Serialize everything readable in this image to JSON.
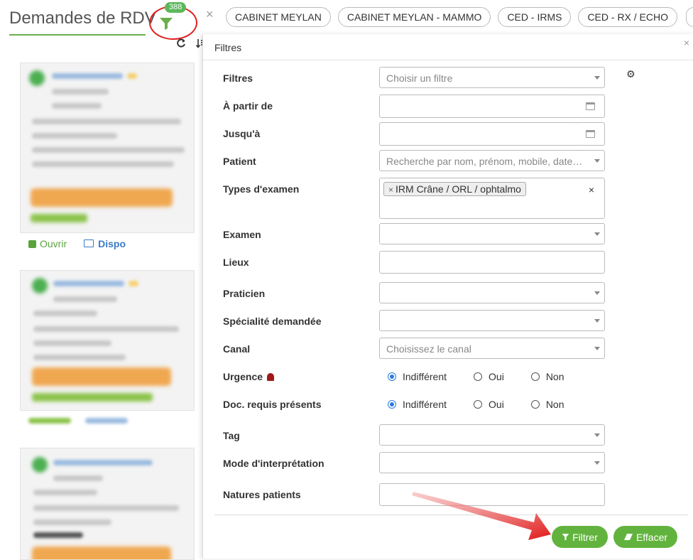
{
  "header": {
    "title": "Demandes de RDV",
    "filter_count": "388",
    "close_symbol": "×"
  },
  "tabs": [
    {
      "label": "CABINET MEYLAN"
    },
    {
      "label": "CABINET MEYLAN - MAMMO"
    },
    {
      "label": "CED - IRMS"
    },
    {
      "label": "CED - RX / ECHO"
    }
  ],
  "card_actions": {
    "open_label": "Ouvrir",
    "dispo_label": "Dispo"
  },
  "panel": {
    "title": "Filtres",
    "close_symbol": "×",
    "rows": {
      "filtres": {
        "label": "Filtres",
        "placeholder": "Choisir un filtre"
      },
      "a_partir_de": {
        "label": "À partir de",
        "value": ""
      },
      "jusqua": {
        "label": "Jusqu'à",
        "value": ""
      },
      "patient": {
        "label": "Patient",
        "placeholder": "Recherche par nom, prénom, mobile, date…"
      },
      "types_examen": {
        "label": "Types d'examen",
        "tags": [
          "IRM Crâne / ORL / ophtalmo"
        ],
        "clear_symbol": "×"
      },
      "examen": {
        "label": "Examen",
        "value": ""
      },
      "lieux": {
        "label": "Lieux",
        "value": ""
      },
      "praticien": {
        "label": "Praticien",
        "value": ""
      },
      "specialite": {
        "label": "Spécialité demandée",
        "value": ""
      },
      "canal": {
        "label": "Canal",
        "placeholder": "Choisissez le canal"
      },
      "urgence": {
        "label": "Urgence",
        "options": [
          "Indifférent",
          "Oui",
          "Non"
        ],
        "selected": "Indifférent"
      },
      "doc_requis": {
        "label": "Doc. requis présents",
        "options": [
          "Indifférent",
          "Oui",
          "Non"
        ],
        "selected": "Indifférent"
      },
      "tag": {
        "label": "Tag",
        "value": ""
      },
      "mode_interpretation": {
        "label": "Mode d'interprétation",
        "value": ""
      },
      "natures_patients": {
        "label": "Natures patients",
        "value": ""
      }
    },
    "buttons": {
      "filter_label": "Filtrer",
      "clear_label": "Effacer"
    }
  },
  "colors": {
    "accent_green": "#62b33e",
    "radio_blue": "#2a7be0",
    "annotation_red": "#e02020",
    "link_blue": "#3a7bc8"
  }
}
